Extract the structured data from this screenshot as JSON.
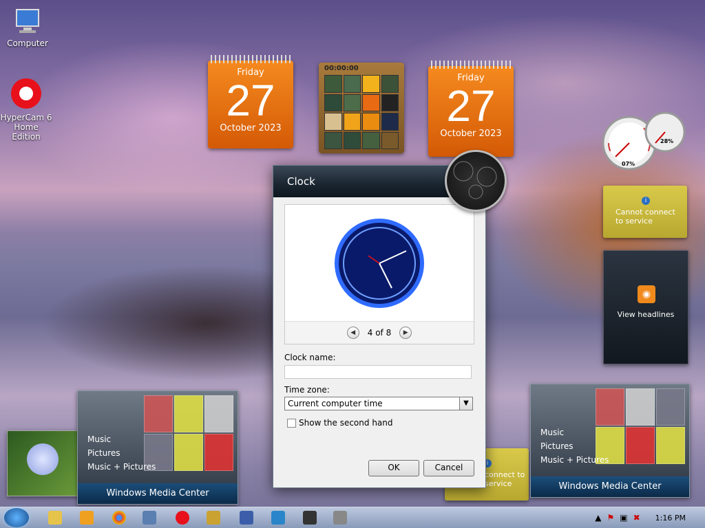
{
  "desktop": {
    "icons": [
      {
        "label": "Computer",
        "icon": "computer-icon"
      },
      {
        "label": "HyperCam 6 Home Edition",
        "icon": "hypercam-icon"
      }
    ]
  },
  "calendar_1": {
    "weekday": "Friday",
    "day": "27",
    "month_year": "October 2023"
  },
  "calendar_2": {
    "weekday": "Friday",
    "day": "27",
    "month_year": "October 2023"
  },
  "puzzle": {
    "timer": "00:00:00"
  },
  "weather_gadget_1": {
    "message": "Cannot connect to service"
  },
  "weather_gadget_2": {
    "message": "connect to service"
  },
  "rss_gadget": {
    "label": "View headlines"
  },
  "cpu_meter": {
    "cpu": "07%",
    "memory": "28%"
  },
  "wmc_left": {
    "items": [
      "Music",
      "Pictures",
      "Music + Pictures"
    ],
    "brand": "Windows Media Center"
  },
  "wmc_right": {
    "items": [
      "Music",
      "Pictures",
      "Music + Pictures"
    ],
    "brand": "Windows Media Center"
  },
  "dialog": {
    "title": "Clock",
    "pager": "4 of 8",
    "clock_name_label": "Clock name:",
    "clock_name_value": "",
    "time_zone_label": "Time zone:",
    "time_zone_value": "Current computer time",
    "second_hand_label": "Show the second hand",
    "ok_label": "OK",
    "cancel_label": "Cancel"
  },
  "taskbar": {
    "time": "1:16 PM",
    "items": [
      "explorer-icon",
      "media-player-icon",
      "chrome-icon",
      "network-icon",
      "hypercam-icon",
      "app-icon",
      "visual-studio-icon",
      "vpn-icon",
      "7zip-icon",
      "usb-icon"
    ]
  },
  "colors": {
    "calendar": "#e8700f",
    "weather": "#cbbc3e",
    "accent": "#1a4f8c"
  }
}
